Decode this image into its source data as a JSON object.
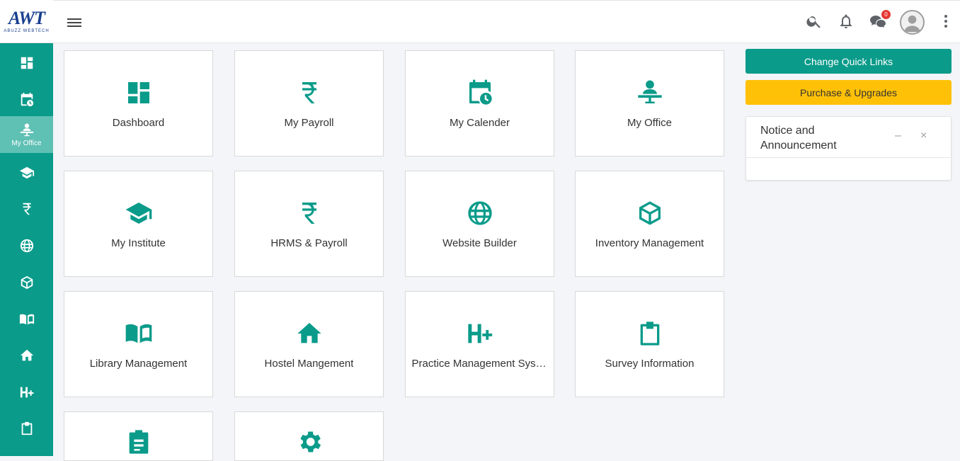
{
  "app": {
    "logo_text": "AWT",
    "logo_sub": "ABUZZ WEBTECH"
  },
  "sidebar": {
    "items": [
      {
        "icon": "dashboard-icon",
        "label": ""
      },
      {
        "icon": "calendar-clock-icon",
        "label": ""
      },
      {
        "icon": "office-desk-icon",
        "label": "My Office",
        "active": true
      },
      {
        "icon": "graduation-cap-icon",
        "label": ""
      },
      {
        "icon": "rupee-icon",
        "label": ""
      },
      {
        "icon": "globe-icon",
        "label": ""
      },
      {
        "icon": "box-icon",
        "label": ""
      },
      {
        "icon": "book-open-icon",
        "label": ""
      },
      {
        "icon": "home-icon",
        "label": ""
      },
      {
        "icon": "hospital-plus-icon",
        "label": ""
      },
      {
        "icon": "clipboard-icon",
        "label": ""
      }
    ]
  },
  "topbar": {
    "chat_badge": "0"
  },
  "modules": [
    {
      "title": "Dashboard",
      "icon": "dashboard-icon"
    },
    {
      "title": "My Payroll",
      "icon": "rupee-icon"
    },
    {
      "title": "My Calender",
      "icon": "calendar-clock-icon"
    },
    {
      "title": "My Office",
      "icon": "office-desk-icon"
    },
    {
      "title": "My Institute",
      "icon": "graduation-cap-icon"
    },
    {
      "title": "HRMS & Payroll",
      "icon": "rupee-icon"
    },
    {
      "title": "Website Builder",
      "icon": "globe-icon"
    },
    {
      "title": "Inventory Management",
      "icon": "box-icon"
    },
    {
      "title": "Library Management",
      "icon": "book-open-icon"
    },
    {
      "title": "Hostel Mangement",
      "icon": "home-icon"
    },
    {
      "title": "Practice Management System",
      "icon": "hospital-plus-icon"
    },
    {
      "title": "Survey Information",
      "icon": "clipboard-icon"
    },
    {
      "title": "",
      "icon": "clipboard-list-icon"
    },
    {
      "title": "",
      "icon": "gear-icon"
    }
  ],
  "right_panel": {
    "change_quick_links": "Change Quick Links",
    "purchase_upgrades": "Purchase & Upgrades",
    "notice_title": "Notice and Announcement",
    "minimize": "–",
    "close": "×"
  },
  "colors": {
    "accent": "#0a9b8a",
    "accent_light": "#5fc0b4",
    "warning": "#ffc107"
  }
}
